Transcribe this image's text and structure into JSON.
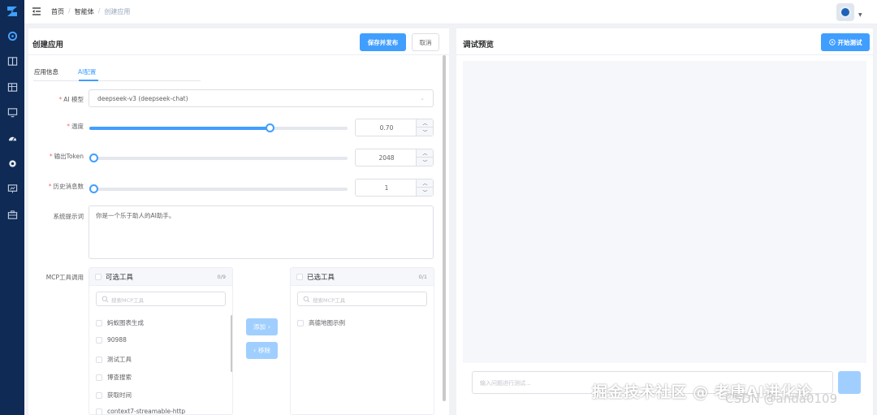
{
  "colors": {
    "sidebar": "#0f2a54",
    "primary": "#409eff",
    "primary_disabled": "#a0cfff",
    "required": "#f56c6c"
  },
  "sidebar": {
    "icons": [
      "logo-icon",
      "dashboard-icon",
      "book-icon",
      "table-icon",
      "monitor-icon",
      "gauge-icon",
      "settings-icon",
      "screen-icon",
      "toolbox-icon"
    ]
  },
  "breadcrumb": {
    "home": "首页",
    "agents": "智能体",
    "current": "创建应用"
  },
  "left_panel": {
    "title": "创建应用",
    "save_label": "保存并发布",
    "cancel_label": "取消",
    "tabs": [
      {
        "label": "应用信息"
      },
      {
        "label": "AI配置"
      }
    ],
    "active_tab": "AI配置",
    "model": {
      "label": "AI 模型",
      "value": "deepseek-v3 (deepseek-chat)"
    },
    "temperature": {
      "label": "温度",
      "value": "0.70",
      "fraction": 0.7
    },
    "max_tokens": {
      "label": "输出Token",
      "value": "2048",
      "fraction": 0.0
    },
    "history": {
      "label": "历史消息数",
      "value": "1",
      "fraction": 0.0
    },
    "system_prompt": {
      "label": "系统提示词",
      "value": "你是一个乐于助人的AI助手。"
    },
    "mcp": {
      "label": "MCP工具调用",
      "available": {
        "title": "可选工具",
        "count": "0/9",
        "search_placeholder": "搜索MCP工具",
        "items": [
          "蚂蚁图表生成",
          "90988",
          "测试工具",
          "博查搜索",
          "获取时间",
          "context7-streamable-http"
        ]
      },
      "selected": {
        "title": "已选工具",
        "count": "0/1",
        "search_placeholder": "搜索MCP工具",
        "items": [
          "高德地图示例"
        ]
      },
      "add_label": "添加",
      "remove_label": "移除"
    }
  },
  "right_panel": {
    "title": "调试预览",
    "start_label": "开始测试",
    "input_placeholder": "输入问题进行测试..."
  },
  "watermark": {
    "text": "掘金技术社区 @ 老唐AI进化论",
    "sub": "CSDN @anda0109"
  }
}
